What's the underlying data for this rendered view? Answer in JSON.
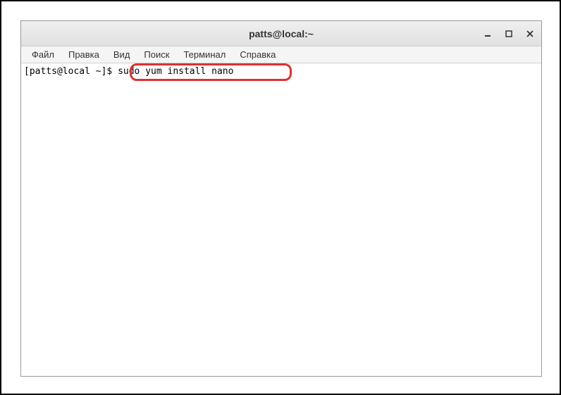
{
  "window": {
    "title": "patts@local:~"
  },
  "menubar": {
    "items": [
      {
        "label": "Файл"
      },
      {
        "label": "Правка"
      },
      {
        "label": "Вид"
      },
      {
        "label": "Поиск"
      },
      {
        "label": "Терминал"
      },
      {
        "label": "Справка"
      }
    ]
  },
  "terminal": {
    "prompt": "[patts@local ~]$ ",
    "command": "sudo yum install nano"
  }
}
